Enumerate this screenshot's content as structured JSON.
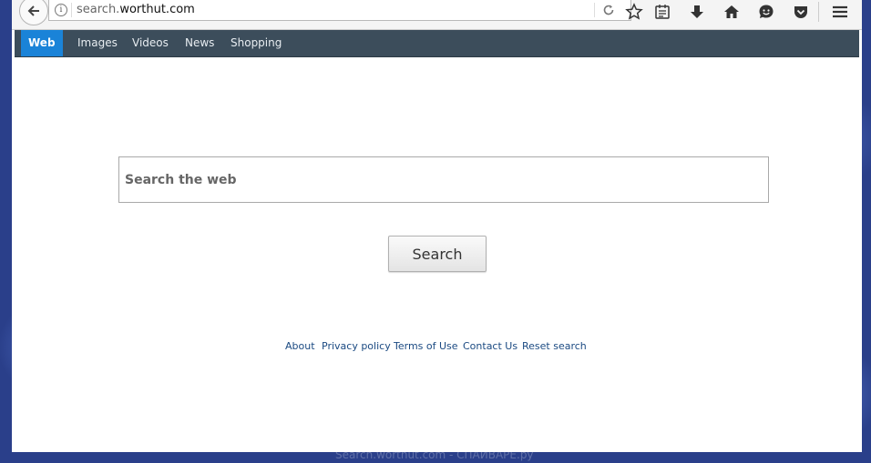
{
  "browser": {
    "url_prefix": "search.",
    "url_domain": "worthut.com"
  },
  "nav": {
    "items": [
      {
        "label": "Web",
        "active": true
      },
      {
        "label": "Images"
      },
      {
        "label": "Videos"
      },
      {
        "label": "News"
      },
      {
        "label": "Shopping"
      }
    ]
  },
  "search": {
    "placeholder": "Search the web",
    "button_label": "Search"
  },
  "footer": {
    "links": [
      "About",
      "Privacy policy",
      "Terms of Use",
      "Contact Us",
      "Reset search"
    ]
  },
  "watermark": "Search.worthut.com - СПАЙВАРЕ.ру",
  "colors": {
    "nav_bg": "#3c4d5b",
    "nav_active": "#1a83d8",
    "link": "#1b4a82"
  }
}
